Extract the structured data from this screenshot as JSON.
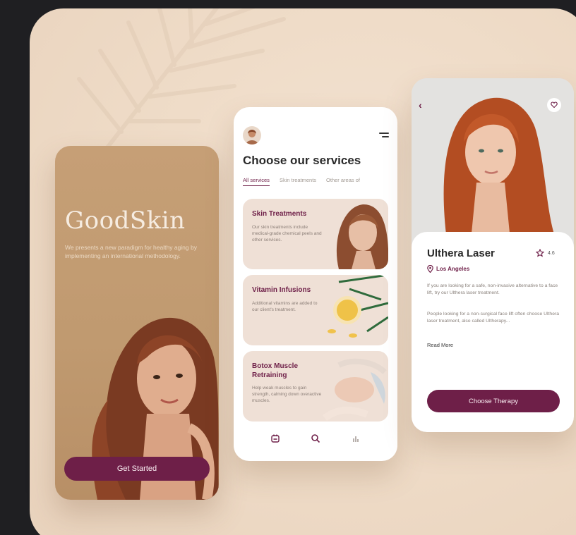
{
  "colors": {
    "accent": "#6e1f48",
    "page_background": "#1f1f22",
    "stage_background": "#efdcc8",
    "brand_card": "#c29c72",
    "service_card": "#efe0d6"
  },
  "intro_screen": {
    "brand": "GoodSkin",
    "tagline": "We presents a new paradigm for healthy aging by implementing an international methodology.",
    "button_label": "Get Started"
  },
  "services_screen": {
    "title": "Choose our services",
    "tabs": [
      {
        "label": "All services",
        "active": true
      },
      {
        "label": "Skin treatments",
        "active": false
      },
      {
        "label": "Other areas of",
        "active": false
      }
    ],
    "cards": [
      {
        "title": "Skin Treatments",
        "description": "Our skin treatments include medical-grade chemical peels and other services."
      },
      {
        "title": "Vitamin Infusions",
        "description": "Additional vitamins are added to our client's treatment."
      },
      {
        "title": "Botox Muscle Retraining",
        "description": "Help weak muscles to gain strength, calming down overactive muscles."
      }
    ],
    "nav_icons": [
      "calendar-icon",
      "search-icon",
      "stats-icon"
    ]
  },
  "detail_screen": {
    "title": "Ulthera Laser",
    "rating": "4.6",
    "location": "Los Angeles",
    "description_1": "If you are looking for a safe, non-invasive alternative to a face lift, try our Ulthera laser treatment.",
    "description_2": "People looking for a non-surgical face lift often choose Ulthera laser treatment, also called Ultherapy...",
    "read_more": "Read More",
    "button_label": "Choose Therapy"
  }
}
